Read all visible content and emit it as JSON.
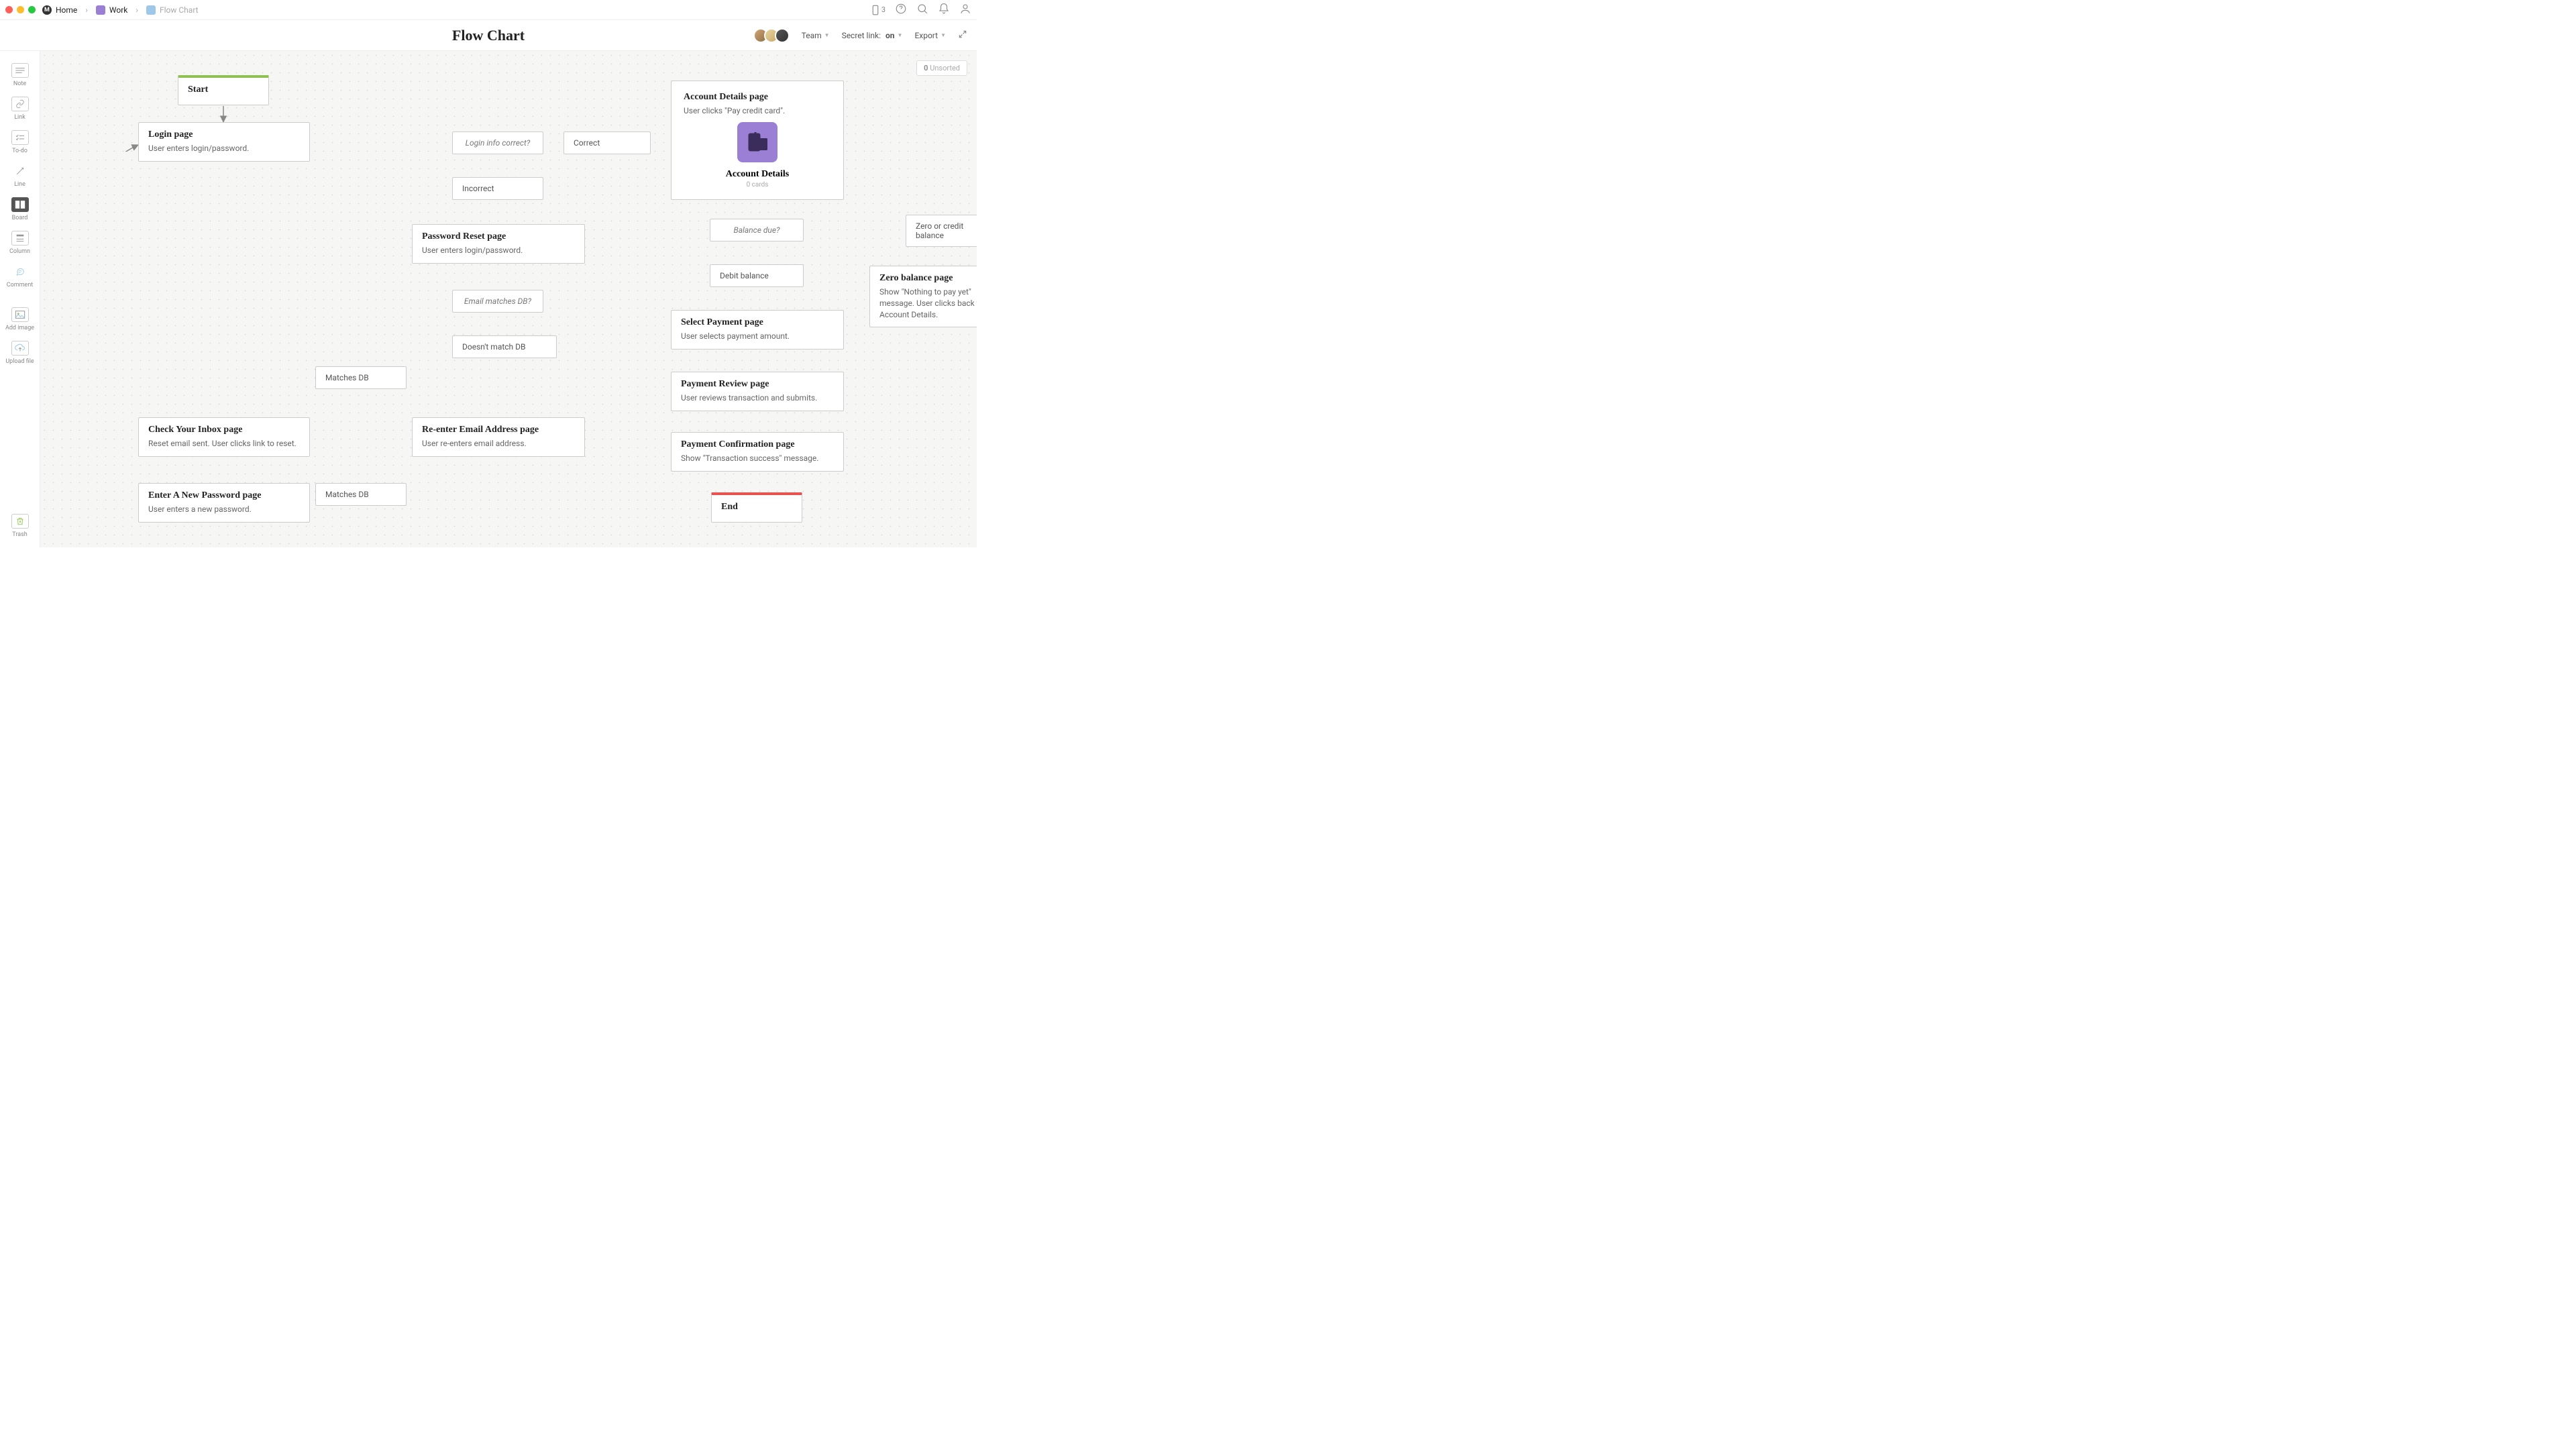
{
  "breadcrumbs": {
    "home": "Home",
    "work": "Work",
    "page": "Flow Chart"
  },
  "topright": {
    "device_count": "3"
  },
  "title": "Flow Chart",
  "titlebar": {
    "team": "Team",
    "secret_label": "Secret link:",
    "secret_state": "on",
    "export": "Export"
  },
  "tools": {
    "note": "Note",
    "link": "Link",
    "todo": "To-do",
    "line": "Line",
    "board": "Board",
    "column": "Column",
    "comment": "Comment",
    "addimg": "Add image",
    "upload": "Upload file",
    "trash": "Trash"
  },
  "unsorted": {
    "count": "0",
    "label": "Unsorted"
  },
  "nodes": {
    "start": "Start",
    "login_t": "Login page",
    "login_d": "User enters login/password.",
    "logincheck": "Login info correct?",
    "correct": "Correct",
    "incorrect": "Incorrect",
    "pwreset_t": "Password Reset page",
    "pwreset_d": "User enters login/password.",
    "emailcheck": "Email matches DB?",
    "nomatch": "Doesn't match DB",
    "matches1": "Matches DB",
    "matches2": "Matches DB",
    "inbox_t": "Check Your Inbox page",
    "inbox_d": "Reset email sent. User clicks link to reset.",
    "newpw_t": "Enter A New Password page",
    "newpw_d": "User enters a new password.",
    "reemail_t": "Re-enter Email Address page",
    "reemail_d": "User re-enters email address.",
    "acct_t": "Account Details page",
    "acct_d": "User clicks \"Pay credit card\".",
    "acct_board": "Account Details",
    "acct_cards": "0 cards",
    "balcheck": "Balance due?",
    "zerocredit": "Zero or credit balance",
    "debit": "Debit balance",
    "zerobal_t": "Zero balance page",
    "zerobal_d": "Show \"Nothing to pay yet\" message. User clicks back to Account Details.",
    "selpay_t": "Select Payment page",
    "selpay_d": "User selects payment amount.",
    "payrev_t": "Payment Review page",
    "payrev_d": "User reviews transaction and submits.",
    "payconf_t": "Payment Confirmation page",
    "payconf_d": "Show \"Transaction success\" message.",
    "end": "End"
  },
  "colors": {
    "green": "#8fc153",
    "red": "#e8524f",
    "gray": "#888",
    "purple": "#9b7fd4"
  }
}
